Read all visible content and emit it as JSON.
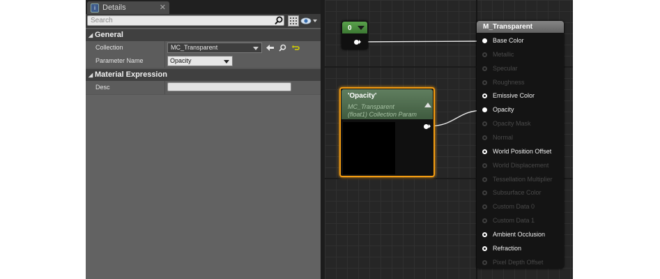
{
  "details_panel": {
    "tab_label": "Details",
    "search_placeholder": "Search",
    "categories": {
      "general": "General",
      "material_expression": "Material Expression"
    },
    "properties": {
      "collection_label": "Collection",
      "collection_value": "MC_Transparent",
      "parameter_name_label": "Parameter Name",
      "parameter_name_value": "Opacity",
      "desc_label": "Desc",
      "desc_value": ""
    }
  },
  "graph": {
    "constant_node": {
      "value": "0"
    },
    "parameter_node": {
      "title": "'Opacity'",
      "subtitle_line1": "MC_Transparent",
      "subtitle_line2": "(float1) Collection Param"
    },
    "material_node": {
      "title": "M_Transparent",
      "pins": [
        {
          "label": "Base Color",
          "active": true,
          "connected": true
        },
        {
          "label": "Metallic",
          "active": false
        },
        {
          "label": "Specular",
          "active": false
        },
        {
          "label": "Roughness",
          "active": false
        },
        {
          "label": "Emissive Color",
          "active": true
        },
        {
          "label": "Opacity",
          "active": true,
          "connected": true
        },
        {
          "label": "Opacity Mask",
          "active": false
        },
        {
          "label": "Normal",
          "active": false
        },
        {
          "label": "World Position Offset",
          "active": true
        },
        {
          "label": "World Displacement",
          "active": false
        },
        {
          "label": "Tessellation Multiplier",
          "active": false
        },
        {
          "label": "Subsurface Color",
          "active": false
        },
        {
          "label": "Custom Data 0",
          "active": false
        },
        {
          "label": "Custom Data 1",
          "active": false
        },
        {
          "label": "Ambient Occlusion",
          "active": true
        },
        {
          "label": "Refraction",
          "active": true
        },
        {
          "label": "Pixel Depth Offset",
          "active": false
        }
      ]
    }
  },
  "colors": {
    "selection_outline": "#f39c12",
    "constant_header": "#4f8f43",
    "parameter_header": "#566f55",
    "material_header": "#767676"
  }
}
